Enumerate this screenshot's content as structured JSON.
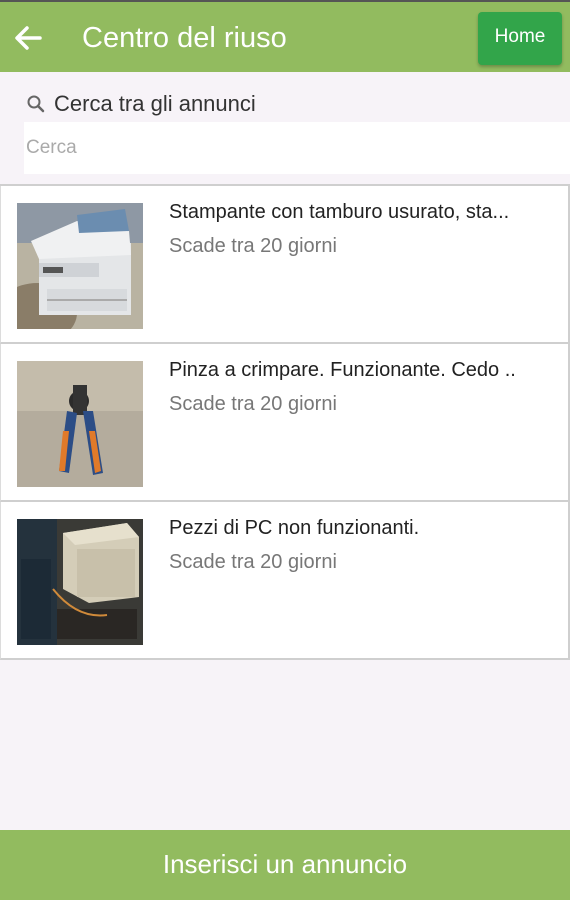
{
  "appbar": {
    "title": "Centro del riuso",
    "home_label": "Home",
    "back_icon": "arrow-left-icon"
  },
  "search": {
    "label": "Cerca tra gli annunci",
    "placeholder": "Cerca",
    "icon": "search-icon"
  },
  "listings": [
    {
      "title": "Stampante con tamburo usurato, sta...",
      "expiry": "Scade tra 20 giorni",
      "image": "printer-photo"
    },
    {
      "title": "Pinza a crimpare. Funzionante. Cedo ..",
      "expiry": "Scade tra 20 giorni",
      "image": "crimping-tool-photo"
    },
    {
      "title": "Pezzi di PC non funzionanti.",
      "expiry": "Scade tra 20 giorni",
      "image": "pc-parts-photo"
    }
  ],
  "footer": {
    "action_label": "Inserisci un annuncio"
  },
  "colors": {
    "appbar": "#92bb5f",
    "home_button": "#32a54a",
    "background": "#f7f3f8"
  }
}
